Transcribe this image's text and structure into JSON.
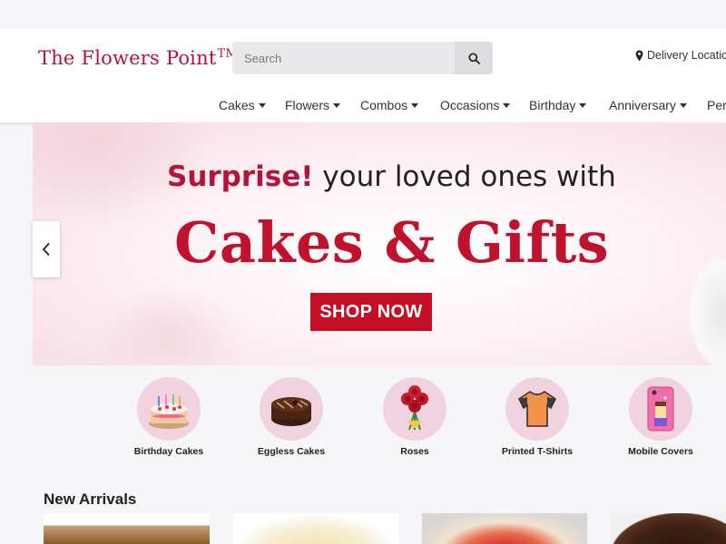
{
  "brand": {
    "name": "The Flowers Point",
    "trademark": "TM"
  },
  "search": {
    "placeholder": "Search",
    "value": ""
  },
  "header": {
    "delivery_label": "Delivery Location"
  },
  "nav": {
    "items": [
      {
        "label": "Cakes"
      },
      {
        "label": "Flowers"
      },
      {
        "label": "Combos"
      },
      {
        "label": "Occasions"
      },
      {
        "label": "Birthday"
      },
      {
        "label": "Anniversary"
      },
      {
        "label": "Pers"
      }
    ]
  },
  "banner": {
    "highlight": "Surprise!",
    "line1_rest": " your loved ones with",
    "line2": "Cakes & Gifts",
    "cta": "SHOP NOW"
  },
  "categories": [
    {
      "label": "Birthday Cakes",
      "icon": "birthday-cake-icon"
    },
    {
      "label": "Eggless Cakes",
      "icon": "chocolate-cake-icon"
    },
    {
      "label": "Roses",
      "icon": "roses-icon"
    },
    {
      "label": "Printed T-Shirts",
      "icon": "tshirt-icon"
    },
    {
      "label": "Mobile Covers",
      "icon": "mobile-cover-icon"
    }
  ],
  "new_arrivals": {
    "title": "New Arrivals"
  },
  "colors": {
    "brand": "#b5123c",
    "cta": "#c40f26",
    "category_circle": "#f0d3de"
  }
}
